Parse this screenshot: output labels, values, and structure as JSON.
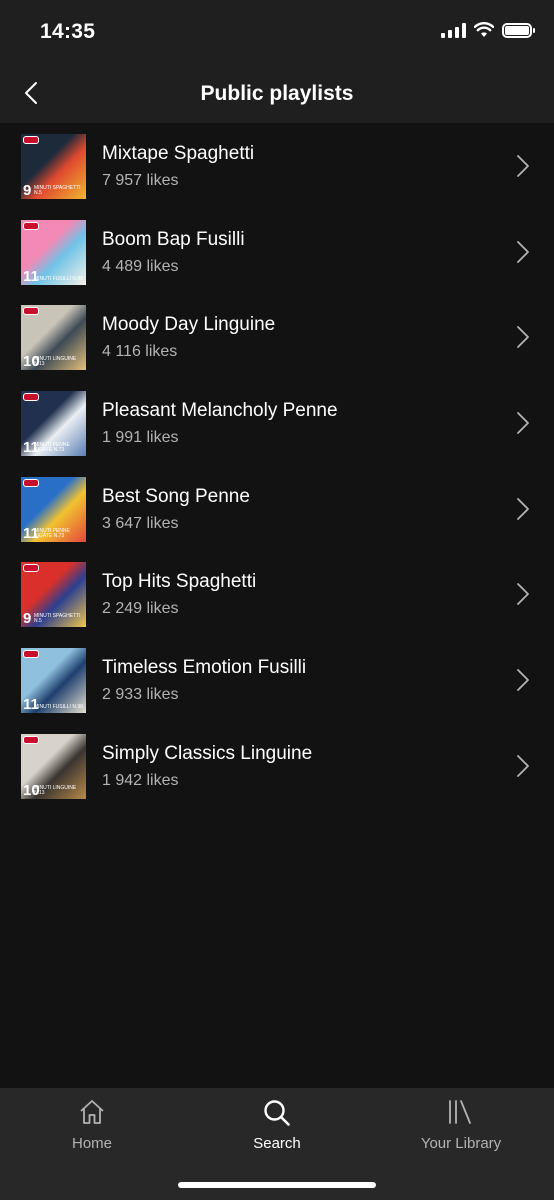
{
  "status_bar": {
    "time": "14:35"
  },
  "header": {
    "title": "Public playlists"
  },
  "playlists": [
    {
      "title": "Mixtape Spaghetti",
      "likes": "7 957 likes",
      "cover_number": "9",
      "cover_caption": "MINUTI SPAGHETTI N.5",
      "cover_colors": [
        "#1c2a3a",
        "#e04a2f",
        "#f0b72f"
      ]
    },
    {
      "title": "Boom Bap Fusilli",
      "likes": "4 489 likes",
      "cover_number": "11",
      "cover_caption": "MINUTI FUSILLI N.98",
      "cover_colors": [
        "#f28ab5",
        "#6fc3e8",
        "#f7f1e6"
      ]
    },
    {
      "title": "Moody Day Linguine",
      "likes": "4 116 likes",
      "cover_number": "10",
      "cover_caption": "MINUTI LINGUINE N.13",
      "cover_colors": [
        "#c9c4b8",
        "#3d4a55",
        "#e6c07b"
      ]
    },
    {
      "title": "Pleasant Melancholy Penne",
      "likes": "1 991 likes",
      "cover_number": "11",
      "cover_caption": "MINUTI PENNE RIGATE N.73",
      "cover_colors": [
        "#20304e",
        "#e9eef2",
        "#5a7fb3"
      ]
    },
    {
      "title": "Best Song Penne",
      "likes": "3 647 likes",
      "cover_number": "11",
      "cover_caption": "MINUTI PENNE RIGATE N.73",
      "cover_colors": [
        "#2a6fc7",
        "#f2c230",
        "#e2473b"
      ]
    },
    {
      "title": "Top Hits Spaghetti",
      "likes": "2 249 likes",
      "cover_number": "9",
      "cover_caption": "MINUTI SPAGHETTI N.5",
      "cover_colors": [
        "#d9302b",
        "#2c3f8f",
        "#f2c84b"
      ]
    },
    {
      "title": "Timeless Emotion Fusilli",
      "likes": "2 933 likes",
      "cover_number": "11",
      "cover_caption": "MINUTI FUSILLI N.98",
      "cover_colors": [
        "#8fc1df",
        "#1f3f6e",
        "#e8e2d2"
      ]
    },
    {
      "title": "Simply Classics Linguine",
      "likes": "1 942 likes",
      "cover_number": "10",
      "cover_caption": "MINUTI LINGUINE N.13",
      "cover_colors": [
        "#d8d3ca",
        "#3a3430",
        "#b88a4a"
      ]
    }
  ],
  "tabs": [
    {
      "label": "Home",
      "icon": "home-icon",
      "active": false
    },
    {
      "label": "Search",
      "icon": "search-icon",
      "active": true
    },
    {
      "label": "Your Library",
      "icon": "library-icon",
      "active": false
    }
  ],
  "colors": {
    "background": "#121212",
    "header": "#1f1f1f",
    "tabbar": "#282828",
    "secondary_text": "#b3b3b3"
  }
}
